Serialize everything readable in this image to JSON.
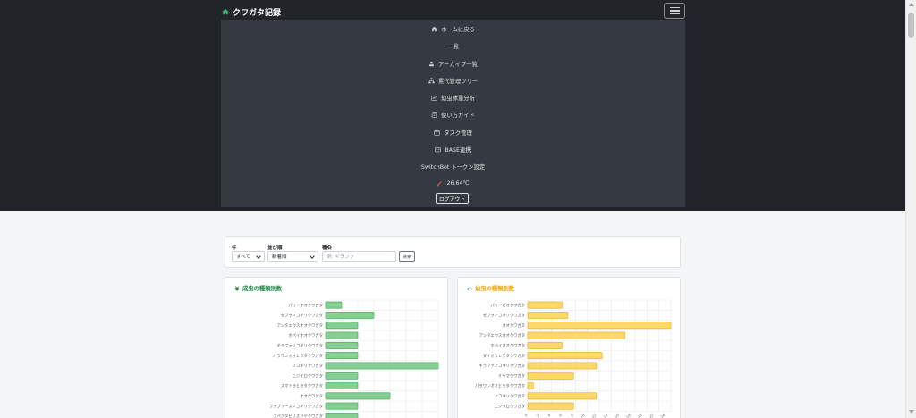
{
  "navbar": {
    "brand": "クワガタ記録",
    "menu": [
      {
        "label": "ホームに戻る",
        "icon": "home-icon"
      },
      {
        "label": "一覧",
        "icon": ""
      },
      {
        "label": "アーカイブ一覧",
        "icon": "archive-user-icon"
      },
      {
        "label": "累代管理ツリー",
        "icon": "tree-icon"
      },
      {
        "label": "幼虫体重分析",
        "icon": "chart-line-icon"
      },
      {
        "label": "使い方ガイド",
        "icon": "guide-icon"
      },
      {
        "label": "タスク管理",
        "icon": "calendar-icon"
      },
      {
        "label": "BASE連携",
        "icon": "store-icon"
      },
      {
        "label": "SwitchBot トークン設定",
        "icon": ""
      }
    ],
    "temperature": "26.64℃",
    "logout": "ログアウト"
  },
  "filters": {
    "year_label": "年",
    "year_value": "すべて",
    "sort_label": "並び順",
    "sort_value": "新着順",
    "species_label": "種名",
    "species_placeholder": "例: ギラファ",
    "search_button": "検索"
  },
  "colors": {
    "adult_fill": "#86cf93",
    "adult_stroke": "#4fae62",
    "adult_title": "#1e8a44",
    "larva_fill": "#ffd86b",
    "larva_stroke": "#e9b423",
    "larva_title": "#f0a500"
  },
  "chart_data": [
    {
      "type": "bar",
      "orientation": "horizontal",
      "title": "成虫の種類別数",
      "categories": [
        "パリーオオクワガタ",
        "ゼブラノコギリクワガタ",
        "アンタエウスオオクワガタ",
        "ホペイオオクワガタ",
        "ギラファノコギリクワガタ",
        "パラワンオオヒラタクワガタ",
        "ノコギリクワガタ",
        "ニジイロクワガタ",
        "スマトラヒラタクワガタ",
        "オオクワガタ",
        "ファブリースノコギリクワガタ",
        "スペクタビリスツヤクワガタ"
      ],
      "values": [
        1,
        3,
        2,
        2,
        2,
        2,
        7,
        2,
        2,
        4,
        2,
        2
      ],
      "xlim": [
        0,
        7
      ]
    },
    {
      "type": "bar",
      "orientation": "horizontal",
      "title": "幼虫の種類別数",
      "categories": [
        "パリーオオクワガタ",
        "ゼブラノコギリクワガタ",
        "オオクワガタ",
        "アンタエウスオオクワガタ",
        "ホペイオオクワガタ",
        "ダイオウヒラタクワガタ",
        "ギラファノコギリクワガタ",
        "ミヤマクワガタ",
        "パラワンオオヒラタクワガタ",
        "ノコギリクワガタ",
        "ニジイロクワガタ"
      ],
      "values": [
        6,
        7,
        25,
        17,
        6,
        13,
        12,
        8,
        1,
        12,
        8
      ],
      "xlim": [
        0,
        25
      ],
      "xticks": [
        "0",
        "2",
        "4",
        "6",
        "8",
        "10",
        "12",
        "14",
        "16",
        "18",
        "20",
        "22",
        "24"
      ]
    }
  ]
}
